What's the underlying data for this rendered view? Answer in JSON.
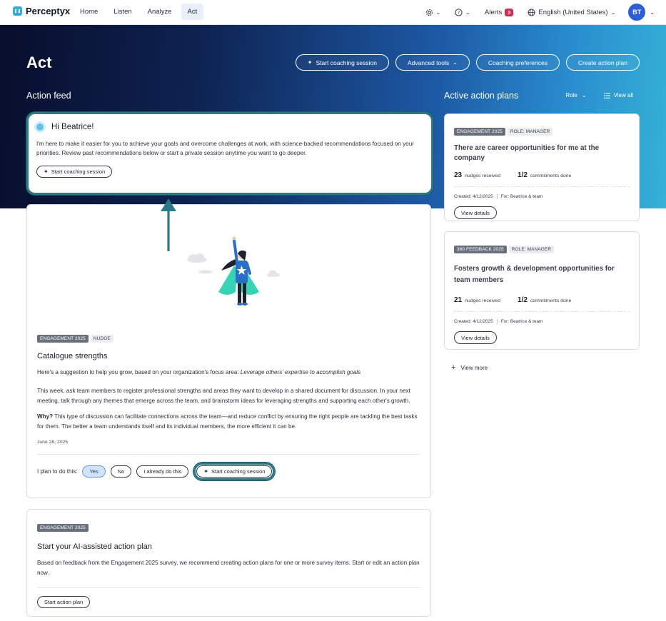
{
  "nav": {
    "brand": "Perceptyx",
    "links": [
      "Home",
      "Listen",
      "Analyze",
      "Act"
    ],
    "active": "Act",
    "alerts_label": "Alerts",
    "alerts_count": "3",
    "language": "English (United States)",
    "avatar_initials": "BT"
  },
  "header": {
    "title": "Act",
    "buttons": [
      "Start coaching session",
      "Advanced tools",
      "Coaching preferences",
      "Create action plan"
    ]
  },
  "feed": {
    "title": "Action feed",
    "greeting": {
      "title": "Hi Beatrice!",
      "text": "I'm here to make it easier for you to achieve your goals and overcome challenges at work, with science-backed recommendations focused on your priorities. Review past recommendations below or start a private session anytime you want to go deeper.",
      "button": "Start coaching session"
    },
    "nudge": {
      "tags": [
        "ENGAGEMENT 2025",
        "NUDGE"
      ],
      "title": "Catalogue strengths",
      "intro_prefix": "Here's a suggestion to help you grow, based on your organization's focus area: ",
      "intro_focus": "Leverage others' expertise to accomplish goals",
      "paragraph": "This week, ask team members to register professional strengths and areas they want to develop in a shared document for discussion. In your next meeting, talk through any themes that emerge across the team, and brainstorm ideas for leveraging strengths and supporting each other's growth.",
      "why_label": "Why?",
      "why_text": " This type of discussion can facilitate connections across the team—and reduce conflict by ensuring the right people are tackling the best tasks for them. The better a team understands itself and its individual members, the more efficient it can be.",
      "date": "June 28, 2025",
      "plan_label": "I plan to do this:",
      "options": [
        "Yes",
        "No",
        "I already do this"
      ],
      "selected": "Yes",
      "coach_button": "Start coaching session"
    },
    "ai_plan": {
      "tag": "ENGAGEMENT 2025",
      "title": "Start your AI-assisted action plan",
      "text": "Based on feedback from the Engagement 2025 survey, we recommend creating action plans for one or more survey items. Start or edit an action plan now.",
      "button": "Start action plan"
    }
  },
  "plans": {
    "title": "Active action plans",
    "role_label": "Role",
    "view_all": "View all",
    "items": [
      {
        "tags": [
          "ENGAGEMENT 2025",
          "ROLE: MANAGER"
        ],
        "title": "There are career opportunities for me at the company",
        "nudges": "23",
        "nudges_label": "nudges received",
        "commitments": "1/2",
        "commitments_label": "commitments done",
        "created": "Created: 4/12/2025",
        "for": "For: Beatrice & team",
        "button": "View details"
      },
      {
        "tags": [
          "360 FEEDBACK 2025",
          "ROLE: MANAGER"
        ],
        "title": "Fosters growth & development opportunities for team members",
        "nudges": "21",
        "nudges_label": "nudges received",
        "commitments": "1/2",
        "commitments_label": "commitments done",
        "created": "Created: 4/12/2025",
        "for": "For: Beatrice & team",
        "button": "View details"
      }
    ],
    "view_more": "View more"
  },
  "colors": {
    "hero_dark": "#080e2c",
    "hero_light": "#35b1d6",
    "highlight": "#2a7a86",
    "selected_option": "#cfe3fb",
    "alert": "#d5294d"
  }
}
